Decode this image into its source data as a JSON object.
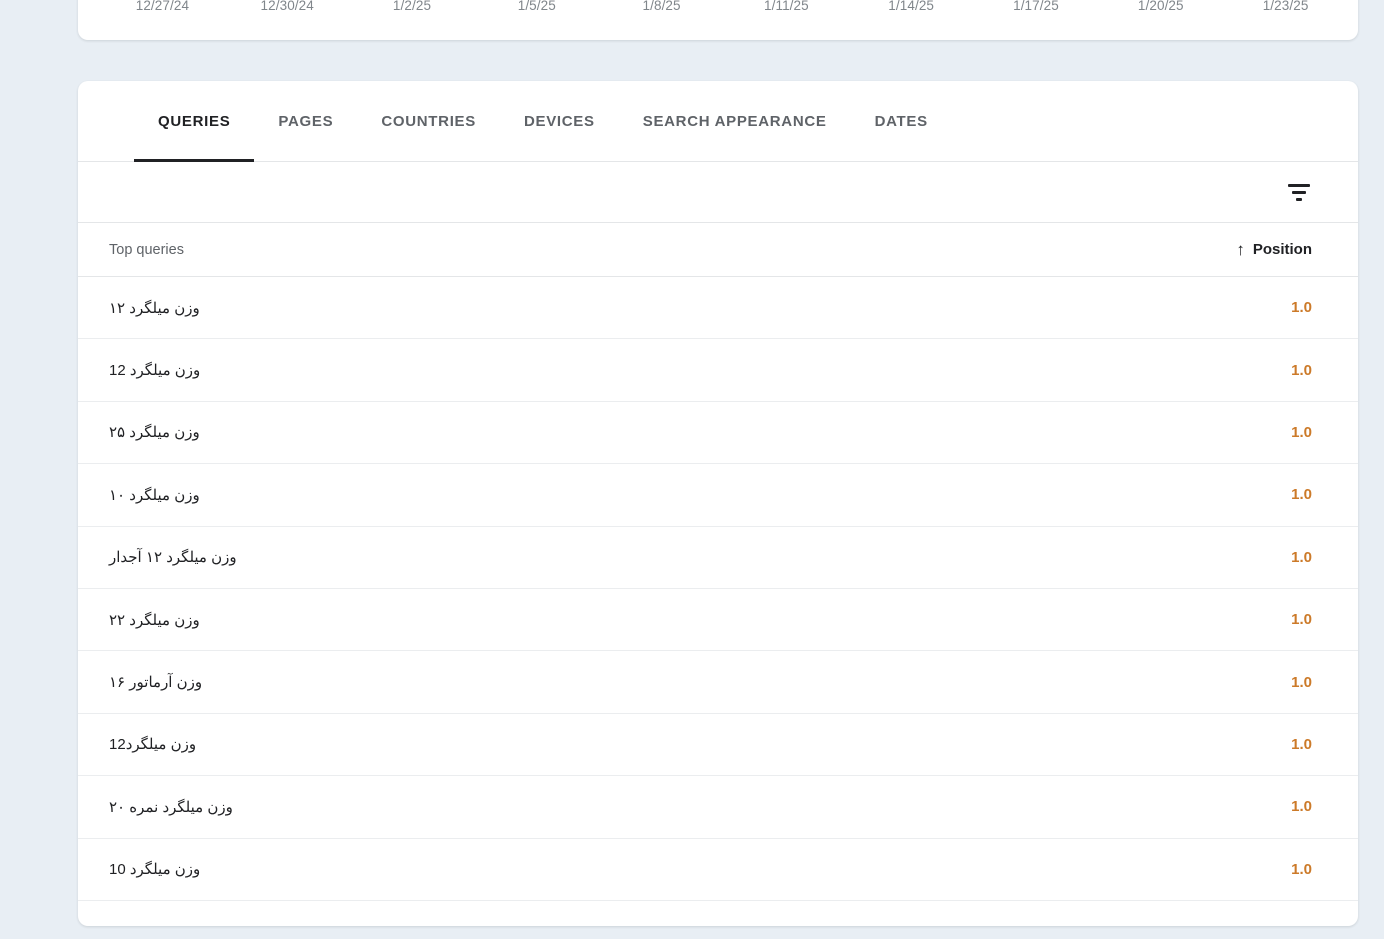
{
  "chart": {
    "x_tick_labels": [
      "12/27/24",
      "12/30/24",
      "1/2/25",
      "1/5/25",
      "1/8/25",
      "1/11/25",
      "1/14/25",
      "1/17/25",
      "1/20/25",
      "1/23/25"
    ]
  },
  "tabs": [
    {
      "label": "QUERIES",
      "active": true
    },
    {
      "label": "PAGES",
      "active": false
    },
    {
      "label": "COUNTRIES",
      "active": false
    },
    {
      "label": "DEVICES",
      "active": false
    },
    {
      "label": "SEARCH APPEARANCE",
      "active": false
    },
    {
      "label": "DATES",
      "active": false
    }
  ],
  "toolbar": {
    "filter_icon": "filter-icon"
  },
  "table": {
    "header": {
      "queries_label": "Top queries",
      "position_label": "Position",
      "sort_arrow": "↑"
    },
    "rows": [
      {
        "query": "وزن میلگرد ۱۲",
        "position": "1.0"
      },
      {
        "query": "وزن میلگرد 12",
        "position": "1.0"
      },
      {
        "query": "وزن میلگرد ۲۵",
        "position": "1.0"
      },
      {
        "query": "وزن میلگرد ۱۰",
        "position": "1.0"
      },
      {
        "query": "وزن میلگرد ۱۲ آجدار",
        "position": "1.0"
      },
      {
        "query": "وزن میلگرد ۲۲",
        "position": "1.0"
      },
      {
        "query": "وزن آرماتور ۱۶",
        "position": "1.0"
      },
      {
        "query": "وزن میلگرد12",
        "position": "1.0"
      },
      {
        "query": "وزن میلگرد نمره ۲۰",
        "position": "1.0"
      },
      {
        "query": "وزن میلگرد 10",
        "position": "1.0"
      }
    ]
  },
  "colors": {
    "background": "#e8eef4",
    "card": "#ffffff",
    "position_value": "#cc7a29",
    "active_tab": "#202124",
    "inactive_tab": "#5f6368"
  }
}
